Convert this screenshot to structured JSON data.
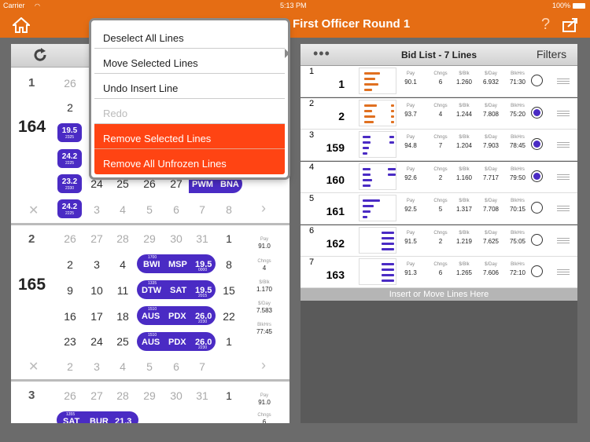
{
  "status": {
    "carrier": "Carrier",
    "time": "5:13 PM",
    "battery": "100%"
  },
  "nav": {
    "title": "First Officer Round 1",
    "home_icon": "home-icon",
    "help_icon": "question-icon",
    "export_icon": "share-icon"
  },
  "menu": {
    "items": [
      "Deselect All Lines",
      "Move Selected Lines",
      "Undo Insert Line",
      "Redo",
      "Remove Selected Lines",
      "Remove All Unfrozen Lines"
    ]
  },
  "left": {
    "blocks": [
      {
        "index": "1",
        "line": "164",
        "weeks": [
          [
            "26",
            "2",
            "19.5",
            "2325",
            "24.2",
            "2225",
            "23.2",
            "2330",
            "24.2",
            "2225"
          ],
          [
            "24",
            "25",
            "26",
            "27",
            "PWM",
            "BNA"
          ],
          [
            "3",
            "4",
            "5",
            "6",
            "7",
            "8"
          ]
        ]
      },
      {
        "index": "2",
        "line": "165",
        "header": [
          "26",
          "27",
          "28",
          "29",
          "30",
          "31",
          "1"
        ],
        "week1": [
          "2",
          "3",
          "4",
          "8"
        ],
        "week2": [
          "9",
          "10",
          "11",
          "15"
        ],
        "week3": [
          "16",
          "17",
          "18",
          "22"
        ],
        "week4": [
          "23",
          "24",
          "25",
          "1"
        ],
        "footer": [
          "2",
          "3",
          "4",
          "5",
          "6",
          "7"
        ],
        "trips": [
          {
            "rep": "1700",
            "from": "BWI",
            "to": "MSP",
            "hours": "19.5",
            "rel": "0000"
          },
          {
            "rep": "1335",
            "from": "DTW",
            "to": "SAT",
            "hours": "19.5",
            "rel": "2015"
          },
          {
            "rep": "1510",
            "from": "AUS",
            "to": "PDX",
            "hours": "26.0",
            "rel": "2230"
          },
          {
            "rep": "1510",
            "from": "AUS",
            "to": "PDX",
            "hours": "26.0",
            "rel": "2230"
          }
        ],
        "stats": [
          {
            "label": "Pay",
            "value": "91.0"
          },
          {
            "label": "Chngs",
            "value": "4"
          },
          {
            "label": "$/Blk",
            "value": "1.170"
          },
          {
            "label": "$/Day",
            "value": "7.583"
          },
          {
            "label": "BlkHrs",
            "value": "77:45"
          }
        ]
      },
      {
        "index": "3",
        "header": [
          "26",
          "27",
          "28",
          "29",
          "30",
          "31",
          "1"
        ],
        "trip": {
          "rep": "1355",
          "from": "SAT",
          "to": "BUR",
          "hours": "21.3"
        },
        "stats": [
          {
            "label": "Pay",
            "value": "91.0"
          },
          {
            "label": "Chngs",
            "value": "6"
          }
        ]
      }
    ]
  },
  "bidlist": {
    "dots": "•••",
    "title": "Bid List - 7 Lines",
    "filters": "Filters",
    "columns": [
      "Pay",
      "Chngs",
      "$/Blk",
      "$/Day",
      "BlkHrs"
    ],
    "rows": [
      {
        "num": "1",
        "line": "1",
        "values": [
          "90.1",
          "6",
          "1.260",
          "6.932",
          "71:30"
        ],
        "selected": false
      },
      {
        "num": "2",
        "line": "2",
        "values": [
          "93.7",
          "4",
          "1.244",
          "7.808",
          "75:20"
        ],
        "selected": true
      },
      {
        "num": "3",
        "line": "159",
        "values": [
          "94.8",
          "7",
          "1.204",
          "7.903",
          "78:45"
        ],
        "selected": true
      },
      {
        "num": "4",
        "line": "160",
        "values": [
          "92.6",
          "2",
          "1.160",
          "7.717",
          "79:50"
        ],
        "selected": true
      },
      {
        "num": "5",
        "line": "161",
        "values": [
          "92.5",
          "5",
          "1.317",
          "7.708",
          "70:15"
        ],
        "selected": false
      },
      {
        "num": "6",
        "line": "162",
        "values": [
          "91.5",
          "2",
          "1.219",
          "7.625",
          "75:05"
        ],
        "selected": false
      },
      {
        "num": "7",
        "line": "163",
        "values": [
          "91.3",
          "6",
          "1.265",
          "7.606",
          "72:10"
        ],
        "selected": false
      }
    ],
    "insert_hint": "Insert or Move Lines Here"
  },
  "colors": {
    "accent": "#e56d14",
    "trip": "#4a2bc4",
    "danger": "#ff4413",
    "thumb_orange": "#e07020"
  }
}
